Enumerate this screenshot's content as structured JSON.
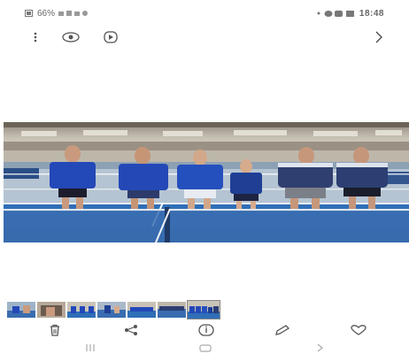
{
  "status": {
    "left_text": "66%",
    "time": "18:48"
  },
  "icons": {
    "toolbar": [
      "more-vert-icon",
      "eye-icon",
      "play-circle-icon",
      "chevron-right-icon"
    ],
    "actions": [
      "trash-icon",
      "share-icon",
      "info-icon",
      "edit-icon",
      "heart-icon"
    ],
    "nav": [
      "recents-icon",
      "home-icon",
      "back-icon"
    ]
  },
  "thumbnails": {
    "count": 7,
    "selected_index": 6
  },
  "colors": {
    "court": "#2f6fb7",
    "jersey": "#2348b8",
    "wall": "#c9c4b8"
  }
}
